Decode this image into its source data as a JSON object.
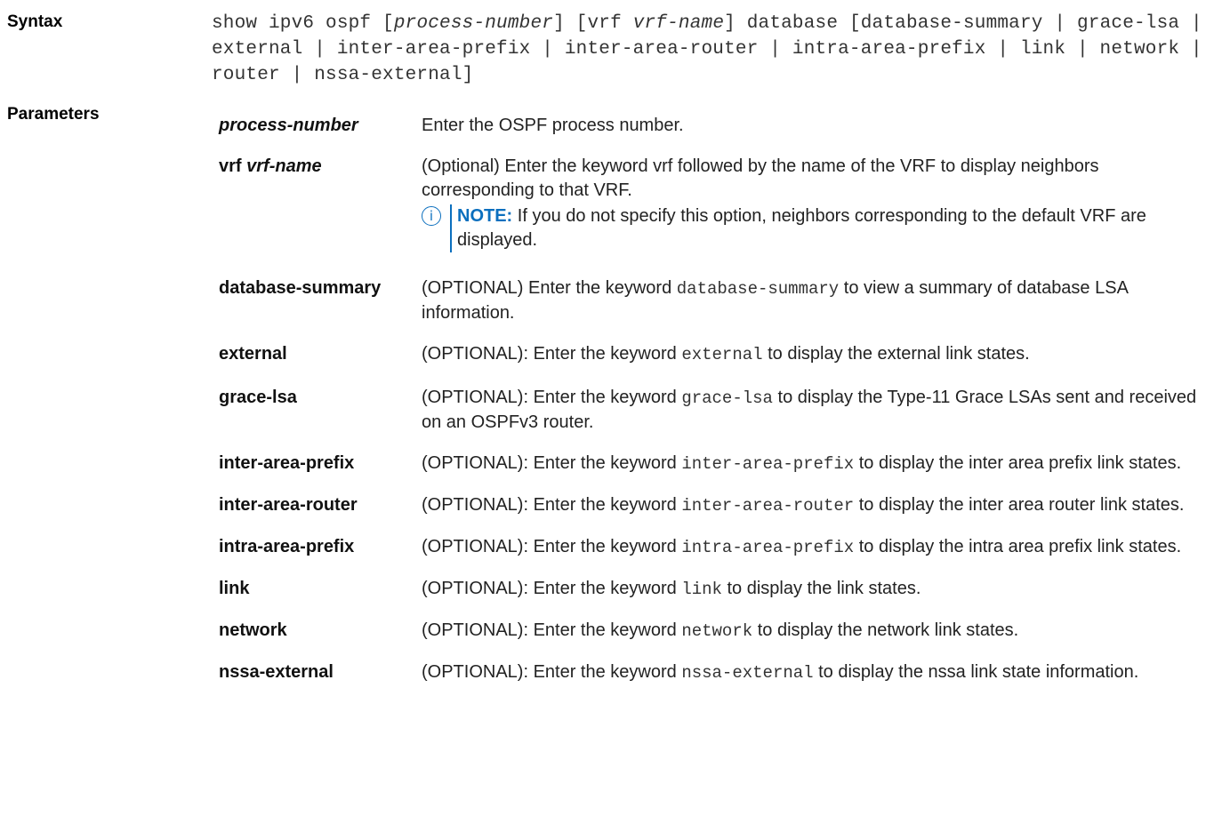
{
  "syntax": {
    "label": "Syntax",
    "cmd_prefix": "show ipv6 ospf [",
    "cmd_arg1": "process-number",
    "cmd_mid": "] [vrf ",
    "cmd_arg2": "vrf-name",
    "cmd_suffix": "] database [database-summary | grace-lsa | external | inter-area-prefix | inter-area-router | intra-area-prefix | link | network | router | nssa-external]"
  },
  "parameters": {
    "label": "Parameters",
    "process_number": {
      "term": "process-number",
      "desc": "Enter the OSPF process number."
    },
    "vrf": {
      "term_kw": "vrf",
      "term_arg": "vrf-name",
      "desc": "(Optional) Enter the keyword vrf followed by the name of the VRF to display neighbors corresponding to that VRF.",
      "note_label": "NOTE:",
      "note_text": "If you do not specify this option, neighbors corresponding to the default VRF are displayed.",
      "note_icon": "info-icon"
    },
    "rows": [
      {
        "term": "database-summary",
        "pre": "(OPTIONAL) Enter the keyword ",
        "kw": "database-summary",
        "post": " to view a summary of database LSA information."
      },
      {
        "term": "external",
        "pre": "(OPTIONAL): Enter the keyword ",
        "kw": "external",
        "post": " to display the external link states."
      },
      {
        "term": "grace-lsa",
        "pre": "(OPTIONAL): Enter the keyword ",
        "kw": "grace-lsa",
        "post": " to display the Type-11 Grace LSAs sent and received on an OSPFv3 router."
      },
      {
        "term": "inter-area-prefix",
        "pre": "(OPTIONAL): Enter the keyword ",
        "kw": "inter-area-prefix",
        "post": " to display the inter area prefix link states."
      },
      {
        "term": "inter-area-router",
        "pre": "(OPTIONAL): Enter the keyword ",
        "kw": "inter-area-router",
        "post": " to display the inter area router link states."
      },
      {
        "term": "intra-area-prefix",
        "pre": "(OPTIONAL): Enter the keyword ",
        "kw": "intra-area-prefix",
        "post": " to display the intra area prefix link states."
      },
      {
        "term": "link",
        "pre": "(OPTIONAL): Enter the keyword ",
        "kw": "link",
        "post": " to display the link states."
      },
      {
        "term": "network",
        "pre": "(OPTIONAL): Enter the keyword ",
        "kw": "network",
        "post": " to display the network link states."
      },
      {
        "term": "nssa-external",
        "pre": "(OPTIONAL): Enter the keyword ",
        "kw": "nssa-external",
        "post": " to display the nssa link state information."
      }
    ]
  }
}
